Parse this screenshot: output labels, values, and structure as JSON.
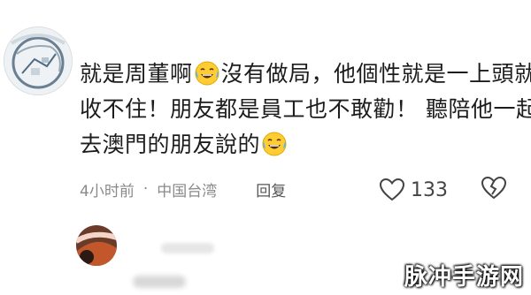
{
  "comment": {
    "line1_a": "就是周董啊",
    "line1_b": "沒有做局，他個性就是一上頭就",
    "line2": "收不住！朋友都是員工也不敢勸！ 聽陪他一起",
    "line3": "去澳門的朋友說的",
    "emoji_name": "laughing-with-tears"
  },
  "meta": {
    "time": "4小时前",
    "separator": "·",
    "location": "中国台湾",
    "reply_label": "回复"
  },
  "actions": {
    "like_count": "133"
  },
  "watermark": {
    "text": "脉冲手游网"
  },
  "colors": {
    "text": "#1c1c1c",
    "meta": "#8a8a8a"
  }
}
